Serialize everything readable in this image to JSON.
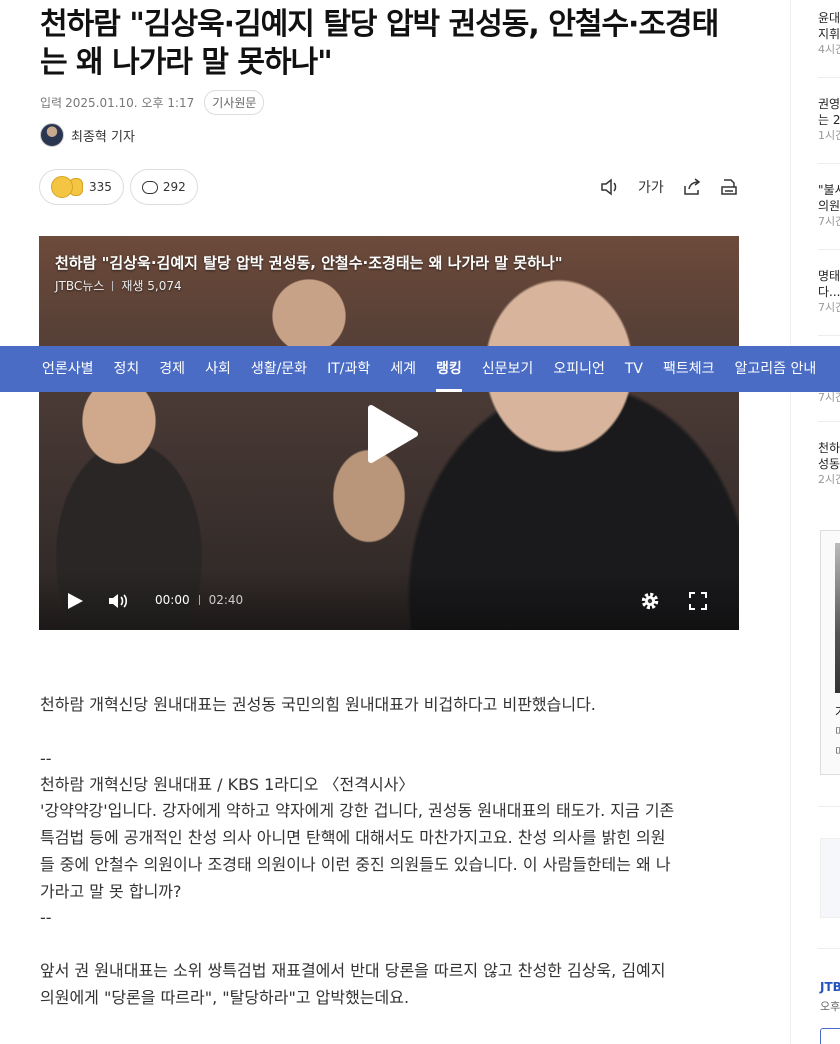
{
  "article": {
    "title": "천하람 \"김상욱·김예지 탈당 압박 권성동, 안철수·조경태는 왜 나가라 말 못하나\"",
    "date_label": "입력",
    "date": "2025.01.10. 오후 1:17",
    "original_label": "기사원문",
    "reporter": "최종혁 기자",
    "reaction_count": "335",
    "comment_count": "292",
    "font_tool_label": "가가"
  },
  "video": {
    "title": "천하람 \"김상욱·김예지 탈당 압박 권성동, 안철수·조경태는 왜 나가라 말 못하나\"",
    "source": "JTBC뉴스",
    "plays": "재생 5,074",
    "current_time": "00:00",
    "duration": "02:40"
  },
  "nav": {
    "items": [
      {
        "label": "언론사별"
      },
      {
        "label": "정치"
      },
      {
        "label": "경제"
      },
      {
        "label": "사회"
      },
      {
        "label": "생활/문화"
      },
      {
        "label": "IT/과학"
      },
      {
        "label": "세계"
      },
      {
        "label": "랭킹"
      },
      {
        "label": "신문보기"
      },
      {
        "label": "오피니언"
      },
      {
        "label": "TV"
      },
      {
        "label": "팩트체크"
      },
      {
        "label": "알고리즘 안내"
      }
    ],
    "active_index": 7
  },
  "body": {
    "p1": "천하람 개혁신당 원내대표는 권성동 국민의힘 원내대표가 비겁하다고 비판했습니다.",
    "dash1": "--",
    "quote_source": "천하람 개혁신당 원내대표 / KBS 1라디오 〈전격시사〉",
    "quote_l1": "'강약약강'입니다. 강자에게 약하고 약자에게 강한 겁니다, 권성동 원내대표의 태도가. 지금 기존",
    "quote_l2": "특검법 등에 공개적인 찬성 의사 아니면 탄핵에 대해서도 마찬가지고요. 찬성 의사를 밝힌 의원",
    "quote_l3": "들 중에 안철수 의원이나 조경태 의원이나 이런 중진 의원들도 있습니다. 이 사람들한테는 왜 나",
    "quote_l4": "가라고 말 못 합니까?",
    "dash2": "--",
    "p3_l1": "앞서 권 원내대표는 소위 쌍특검법 재표결에서 반대 당론을 따르지 않고 찬성한 김상욱, 김예지",
    "p3_l2": "의원에게 \"당론을 따르라\", \"탈당하라\"고 압박했는데요."
  },
  "sidebar": {
    "items": [
      {
        "text1": "윤대",
        "text2": "지휘",
        "time": "4시간"
      },
      {
        "text1": "권영",
        "text2": "는 2",
        "time": "1시간"
      },
      {
        "text1": "\"불시",
        "text2": "의원",
        "time": "7시간"
      },
      {
        "text1": "명태",
        "text2": "다...",
        "time": "7시간"
      },
      {
        "text1": "",
        "text2": "",
        "time": "7시간"
      },
      {
        "text1": "천하",
        "text2": "성동",
        "time": "2시간"
      }
    ],
    "ad_caption1": "가",
    "ad_caption2": "미",
    "ad_caption3": "미",
    "logo": "JTBC",
    "logo_sub": "오후"
  }
}
